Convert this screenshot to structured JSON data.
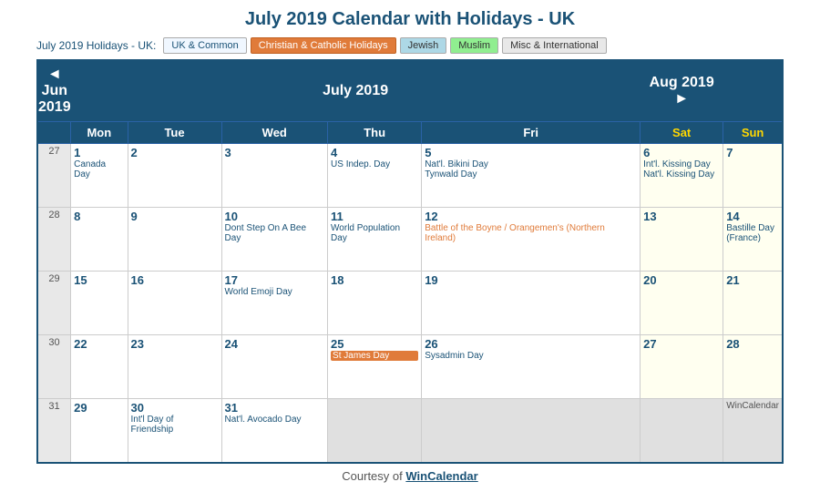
{
  "page": {
    "title": "July 2019 Calendar with Holidays - UK"
  },
  "legend": {
    "label": "July 2019 Holidays - UK:",
    "buttons": [
      {
        "key": "uk",
        "label": "UK & Common",
        "cls": "legend-uk"
      },
      {
        "key": "christian",
        "label": "Christian & Catholic Holidays",
        "cls": "legend-christian"
      },
      {
        "key": "jewish",
        "label": "Jewish",
        "cls": "legend-jewish"
      },
      {
        "key": "muslim",
        "label": "Muslim",
        "cls": "legend-muslim"
      },
      {
        "key": "misc",
        "label": "Misc & International",
        "cls": "legend-misc"
      }
    ]
  },
  "nav": {
    "prev": "◄ Jun 2019",
    "next": "Aug 2019 ►",
    "month": "July 2019"
  },
  "headers": [
    "Mon",
    "Tue",
    "Wed",
    "Thu",
    "Fri",
    "Sat",
    "Sun"
  ],
  "weeks": [
    {
      "num": 27,
      "days": [
        {
          "date": "1",
          "events": [
            {
              "text": "Canada Day",
              "cls": "holiday-text"
            }
          ]
        },
        {
          "date": "2",
          "events": []
        },
        {
          "date": "3",
          "events": []
        },
        {
          "date": "4",
          "events": [
            {
              "text": "US Indep. Day",
              "cls": "holiday-text"
            }
          ]
        },
        {
          "date": "5",
          "events": [
            {
              "text": "Nat'l. Bikini Day",
              "cls": "holiday-text"
            },
            {
              "text": "Tynwald Day",
              "cls": "holiday-text"
            }
          ]
        },
        {
          "date": "6",
          "events": [
            {
              "text": "Int'l. Kissing Day",
              "cls": "holiday-text"
            },
            {
              "text": "Nat'l. Kissing Day",
              "cls": "holiday-text"
            }
          ],
          "isSat": true
        },
        {
          "date": "7",
          "events": [],
          "isSun": true
        }
      ]
    },
    {
      "num": 28,
      "days": [
        {
          "date": "8",
          "events": []
        },
        {
          "date": "9",
          "events": []
        },
        {
          "date": "10",
          "events": [
            {
              "text": "Dont Step On A Bee Day",
              "cls": "holiday-text"
            }
          ]
        },
        {
          "date": "11",
          "events": [
            {
              "text": "World Population Day",
              "cls": "holiday-text"
            }
          ]
        },
        {
          "date": "12",
          "events": [
            {
              "text": "Battle of the Boyne / Orangemen's (Northern Ireland)",
              "cls": "holiday-text orange"
            }
          ]
        },
        {
          "date": "13",
          "events": [],
          "isSat": true
        },
        {
          "date": "14",
          "events": [
            {
              "text": "Bastille Day (France)",
              "cls": "holiday-text"
            }
          ],
          "isSun": true
        }
      ]
    },
    {
      "num": 29,
      "days": [
        {
          "date": "15",
          "events": []
        },
        {
          "date": "16",
          "events": []
        },
        {
          "date": "17",
          "events": [
            {
              "text": "World Emoji Day",
              "cls": "holiday-text"
            }
          ]
        },
        {
          "date": "18",
          "events": []
        },
        {
          "date": "19",
          "events": []
        },
        {
          "date": "20",
          "events": [],
          "isSat": true
        },
        {
          "date": "21",
          "events": [],
          "isSun": true
        }
      ]
    },
    {
      "num": 30,
      "days": [
        {
          "date": "22",
          "events": []
        },
        {
          "date": "23",
          "events": []
        },
        {
          "date": "24",
          "events": []
        },
        {
          "date": "25",
          "events": [
            {
              "text": "St James Day",
              "cls": "holiday-text highlight-orange"
            }
          ]
        },
        {
          "date": "26",
          "events": [
            {
              "text": "Sysadmin Day",
              "cls": "holiday-text"
            }
          ]
        },
        {
          "date": "27",
          "events": [],
          "isSat": true
        },
        {
          "date": "28",
          "events": [],
          "isSun": true
        }
      ]
    },
    {
      "num": 31,
      "days": [
        {
          "date": "29",
          "events": []
        },
        {
          "date": "30",
          "events": [
            {
              "text": "Int'l Day of Friendship",
              "cls": "holiday-text"
            }
          ]
        },
        {
          "date": "31",
          "events": [
            {
              "text": "Nat'l. Avocado Day",
              "cls": "holiday-text"
            }
          ]
        },
        {
          "date": "",
          "events": [],
          "inactive": true
        },
        {
          "date": "",
          "events": [],
          "inactive": true
        },
        {
          "date": "",
          "events": [],
          "inactive": true,
          "isSat": true
        },
        {
          "date": "",
          "events": [],
          "inactive": true,
          "isSun": true
        }
      ]
    }
  ],
  "footer": {
    "wincal": "WinCalendar",
    "courtesy": "Courtesy of",
    "courtesy_link": "WinCalendar"
  }
}
